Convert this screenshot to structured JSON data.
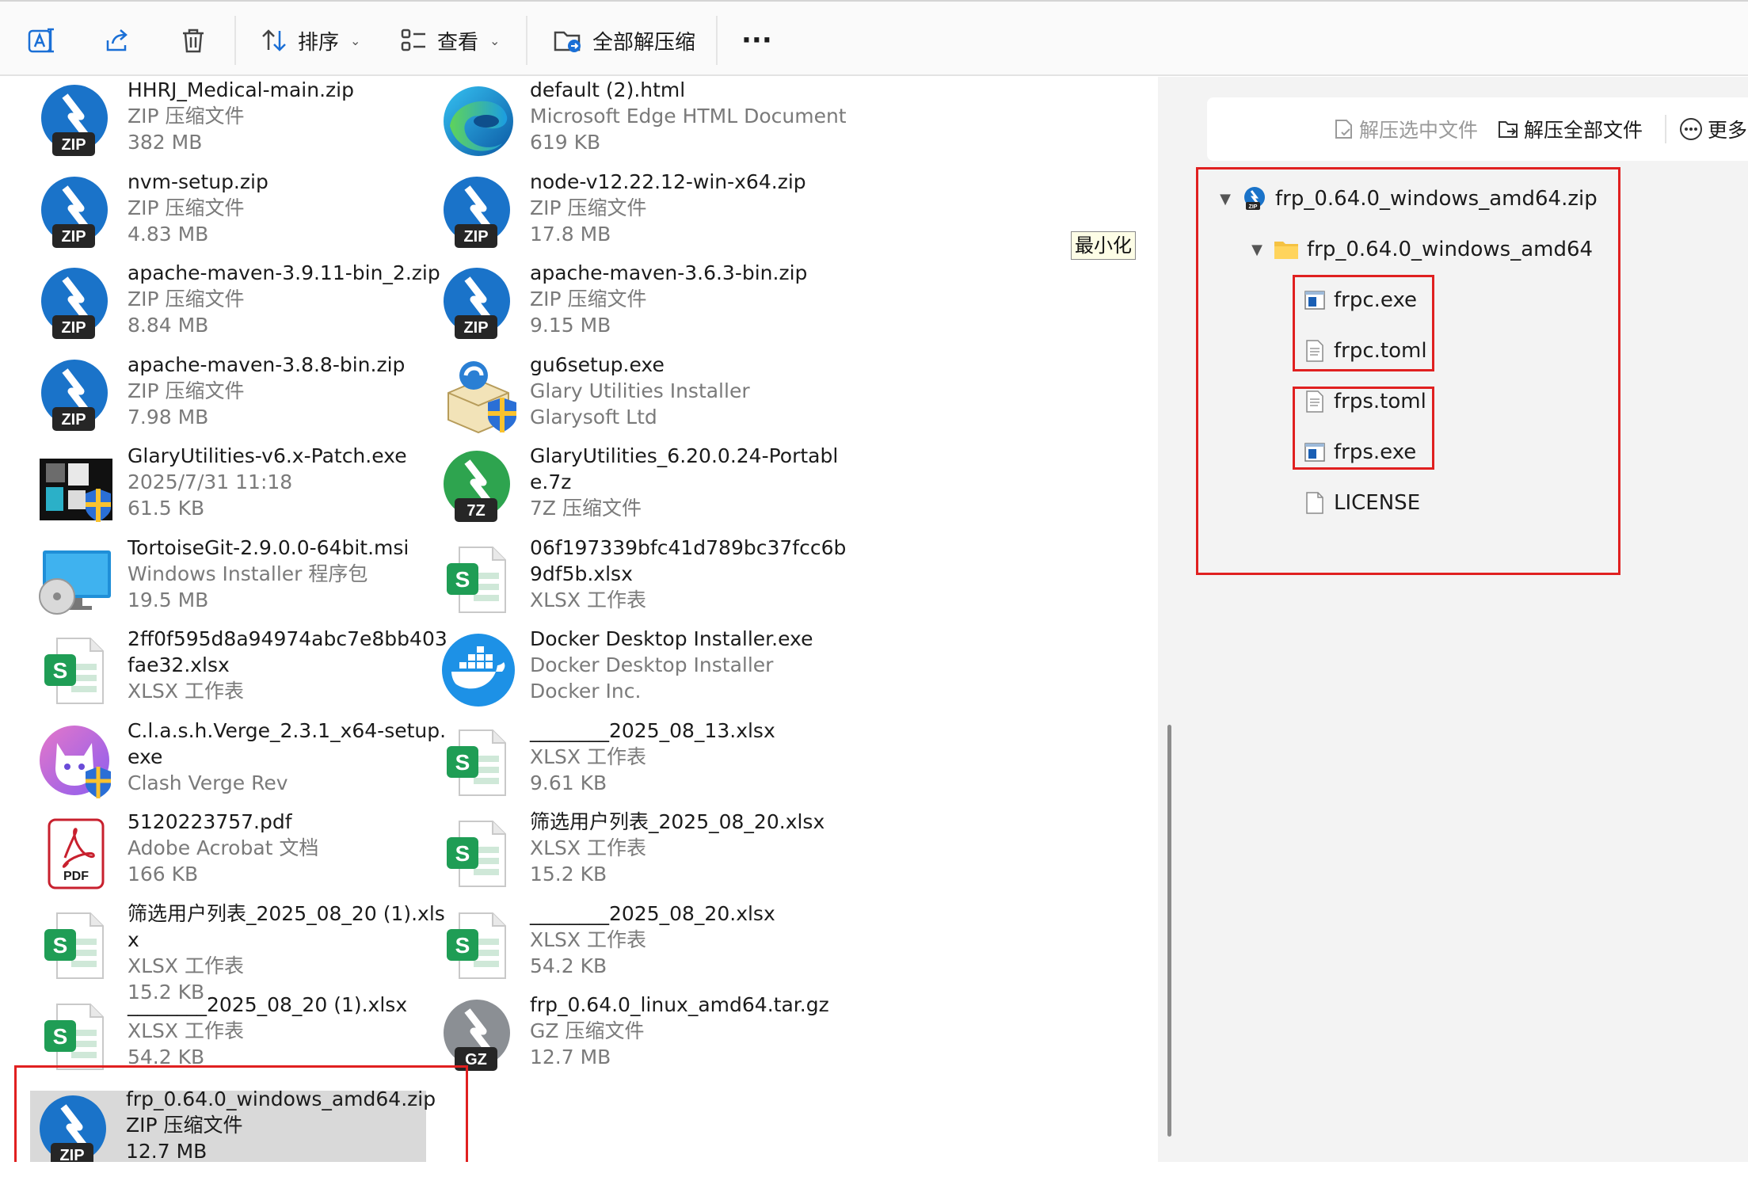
{
  "toolbar": {
    "sort_label": "排序",
    "view_label": "查看",
    "extract_all_label": "全部解压缩",
    "more_label": "···"
  },
  "tooltip": {
    "minimize_label": "最小化"
  },
  "files": [
    {
      "name": "HHRJ_Medical-main.zip",
      "type": "ZIP 压缩文件",
      "size": "382 MB",
      "icon": "zip-archive-icon",
      "badge": "ZIP"
    },
    {
      "name": "default (2).html",
      "type": "Microsoft Edge HTML Document",
      "size": "619 KB",
      "icon": "edge-html-icon"
    },
    {
      "name": "nvm-setup.zip",
      "type": "ZIP 压缩文件",
      "size": "4.83 MB",
      "icon": "zip-archive-icon",
      "badge": "ZIP"
    },
    {
      "name": "node-v12.22.12-win-x64.zip",
      "type": "ZIP 压缩文件",
      "size": "17.8 MB",
      "icon": "zip-archive-icon",
      "badge": "ZIP"
    },
    {
      "name": "apache-maven-3.9.11-bin_2.zip",
      "type": "ZIP 压缩文件",
      "size": "8.84 MB",
      "icon": "zip-archive-icon",
      "badge": "ZIP"
    },
    {
      "name": "apache-maven-3.6.3-bin.zip",
      "type": "ZIP 压缩文件",
      "size": "9.15 MB",
      "icon": "zip-archive-icon",
      "badge": "ZIP"
    },
    {
      "name": "apache-maven-3.8.8-bin.zip",
      "type": "ZIP 压缩文件",
      "size": "7.98 MB",
      "icon": "zip-archive-icon",
      "badge": "ZIP"
    },
    {
      "name": "gu6setup.exe",
      "type": "Glary Utilities Installer",
      "size": "Glarysoft Ltd",
      "icon": "installer-box-icon"
    },
    {
      "name": "GlaryUtilities-v6.x-Patch.exe",
      "type": "2025/7/31 11:18",
      "size": "61.5 KB",
      "icon": "patch-exe-icon"
    },
    {
      "name": "GlaryUtilities_6.20.0.24-Portable.7z",
      "type": "7Z 压缩文件",
      "size": "",
      "icon": "7z-archive-icon",
      "badge": "7Z"
    },
    {
      "name": "TortoiseGit-2.9.0.0-64bit.msi",
      "type": "Windows Installer 程序包",
      "size": "19.5 MB",
      "icon": "msi-installer-icon"
    },
    {
      "name": "06f197339bfc41d789bc37fcc6b9df5b.xlsx",
      "type": "XLSX 工作表",
      "size": "",
      "icon": "spreadsheet-icon"
    },
    {
      "name": "2ff0f595d8a94974abc7e8bb403fae32.xlsx",
      "type": "XLSX 工作表",
      "size": "",
      "icon": "spreadsheet-icon"
    },
    {
      "name": "Docker Desktop Installer.exe",
      "type": "Docker Desktop Installer",
      "size": "Docker Inc.",
      "icon": "docker-icon"
    },
    {
      "name": "C.l.a.s.h.Verge_2.3.1_x64-setup.exe",
      "type": "Clash Verge Rev",
      "size": "",
      "icon": "clash-cat-icon"
    },
    {
      "name": "________2025_08_13.xlsx",
      "type": "XLSX 工作表",
      "size": "9.61 KB",
      "icon": "spreadsheet-icon"
    },
    {
      "name": "5120223757.pdf",
      "type": "Adobe Acrobat 文档",
      "size": "166 KB",
      "icon": "pdf-icon"
    },
    {
      "name": "筛选用户列表_2025_08_20.xlsx",
      "type": "XLSX 工作表",
      "size": "15.2 KB",
      "icon": "spreadsheet-icon"
    },
    {
      "name": "筛选用户列表_2025_08_20 (1).xlsx",
      "type": "XLSX 工作表",
      "size": "15.2 KB",
      "icon": "spreadsheet-icon"
    },
    {
      "name": "________2025_08_20.xlsx",
      "type": "XLSX 工作表",
      "size": "54.2 KB",
      "icon": "spreadsheet-icon"
    },
    {
      "name": "________2025_08_20 (1).xlsx",
      "type": "XLSX 工作表",
      "size": "54.2 KB",
      "icon": "spreadsheet-icon"
    },
    {
      "name": "frp_0.64.0_linux_amd64.tar.gz",
      "type": "GZ 压缩文件",
      "size": "12.7 MB",
      "icon": "gz-archive-icon",
      "badge": "GZ"
    },
    {
      "name": "frp_0.64.0_windows_amd64.zip",
      "type": "ZIP 压缩文件",
      "size": "12.7 MB",
      "icon": "zip-archive-icon",
      "badge": "ZIP",
      "selected": true
    }
  ],
  "pane": {
    "extract_selected_label": "解压选中文件",
    "extract_all_label": "解压全部文件",
    "more_label": "更多",
    "tree": {
      "root": "frp_0.64.0_windows_amd64.zip",
      "folder": "frp_0.64.0_windows_amd64",
      "children": [
        {
          "name": "frpc.exe",
          "icon": "exe-file-icon"
        },
        {
          "name": "frpc.toml",
          "icon": "text-file-icon"
        },
        {
          "name": "frps.toml",
          "icon": "text-file-icon"
        },
        {
          "name": "frps.exe",
          "icon": "exe-file-icon"
        },
        {
          "name": "LICENSE",
          "icon": "blank-file-icon"
        }
      ]
    }
  },
  "colors": {
    "zip_blue": "#1a73c9",
    "zip_dark": "#262626",
    "seven_z_green": "#2ea44f",
    "gz_gray": "#8b8f94",
    "sheet_green": "#1f9d55",
    "highlight_red": "#e02020",
    "selection_gray": "#d9d9d9"
  }
}
